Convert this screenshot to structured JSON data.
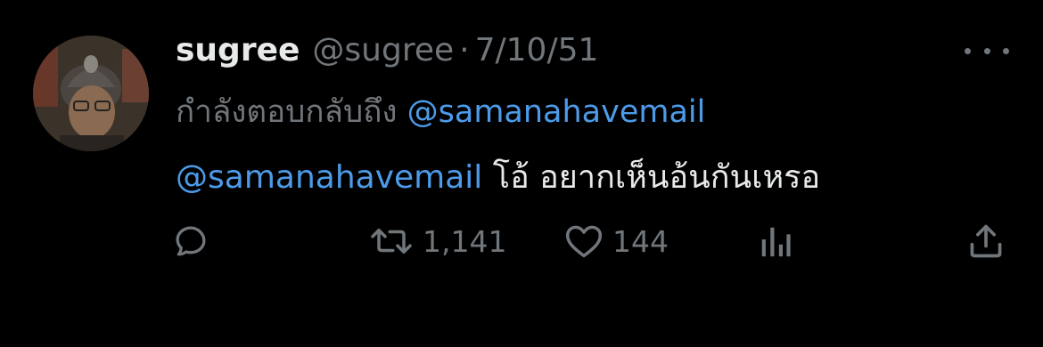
{
  "tweet": {
    "display_name": "sugree",
    "handle": "@sugree",
    "separator": "·",
    "date": "7/10/51",
    "reply_prefix": "กำลังตอบกลับถึง",
    "reply_mention": "@samanahavemail",
    "body_mention": "@samanahavemail",
    "body_text": " โอ้ อยากเห็นอ้นกันเหรอ"
  },
  "actions": {
    "reply_icon": "reply-bubble-icon",
    "retweet_icon": "retweet-icon",
    "retweet_count": "1,141",
    "like_icon": "heart-icon",
    "like_count": "144",
    "views_icon": "views-bar-chart-icon",
    "share_icon": "share-upload-icon",
    "more_icon": "more-dots-icon"
  },
  "colors": {
    "background": "#000000",
    "primary_text": "#e7e9ea",
    "secondary_text": "#71767b",
    "link": "#4d9be8"
  }
}
